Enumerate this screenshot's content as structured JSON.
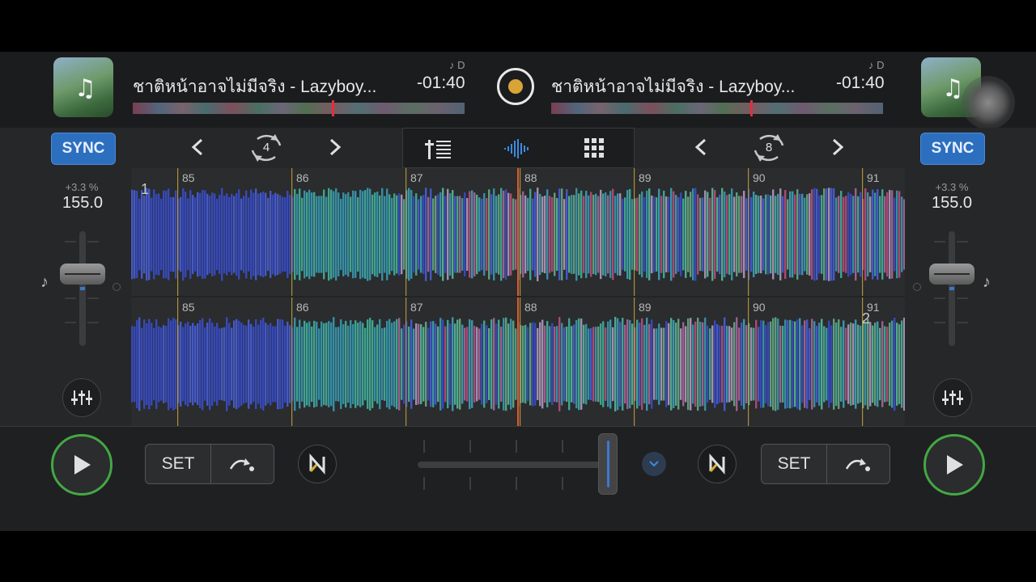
{
  "deck_a": {
    "track_title": "ชาติหน้าอาจไม่มีจริง - Lazyboy...",
    "time_remaining": "-01:40",
    "key_label": "♪ D",
    "sync_label": "SYNC",
    "pitch_percent": "+3.3 %",
    "bpm": "155.0",
    "loop_size": "4",
    "deck_number": "1",
    "cue_set_label": "SET",
    "overview_progress": 0.6
  },
  "deck_b": {
    "track_title": "ชาติหน้าอาจไม่มีจริง - Lazyboy...",
    "time_remaining": "-01:40",
    "key_label": "♪ D",
    "sync_label": "SYNC",
    "pitch_percent": "+3.3 %",
    "bpm": "155.0",
    "loop_size": "8",
    "deck_number": "2",
    "cue_set_label": "SET",
    "overview_progress": 0.6
  },
  "beat_markers": [
    "85",
    "86",
    "87",
    "88",
    "89",
    "90",
    "91"
  ],
  "crossfader_position": 0.98,
  "colors": {
    "sync_blue": "#2c6fbf",
    "play_green": "#43a843",
    "playhead": "#e05a30",
    "beat_marker": "#c8a23a",
    "center_knob_dot": "#d9a437"
  },
  "icons": {
    "mode_tabs": [
      "mixer-icon",
      "waveform-icon",
      "pads-grid-icon"
    ],
    "nav": [
      "chevron-left-icon",
      "loop-icon",
      "chevron-right-icon"
    ]
  }
}
